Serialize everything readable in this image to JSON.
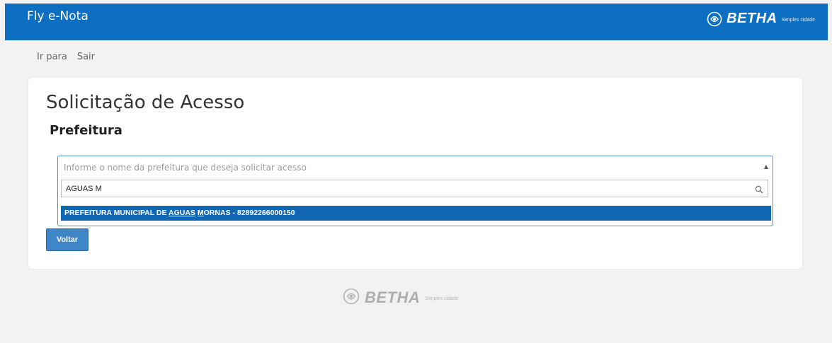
{
  "header": {
    "app_title": "Fly e-Nota",
    "brand_name": "BETHA",
    "brand_sub": "Simples cidade"
  },
  "nav": {
    "items": [
      {
        "label": "Ir para"
      },
      {
        "label": "Sair"
      }
    ]
  },
  "page": {
    "title": "Solicitação de Acesso",
    "subtitle": "Prefeitura"
  },
  "select": {
    "placeholder": "Informe o nome da prefeitura que deseja solicitar acesso",
    "search_value": "AGUAS M",
    "result": {
      "prefix": "PREFEITURA MUNICIPAL DE ",
      "match_a": "AGUAS",
      "space": " ",
      "match_b": "M",
      "suffix": "ORNAS - 82892266000150"
    }
  },
  "buttons": {
    "back": "Voltar"
  },
  "footer": {
    "brand_name": "BETHA",
    "brand_sub": "Simples cidade"
  },
  "colors": {
    "header_bg": "#0d6fc1",
    "highlight": "#1166b4",
    "button": "#3e86c8"
  },
  "icons": {
    "brand": "betha-logo-icon",
    "search": "search-icon",
    "dropdown": "caret-up-icon"
  }
}
